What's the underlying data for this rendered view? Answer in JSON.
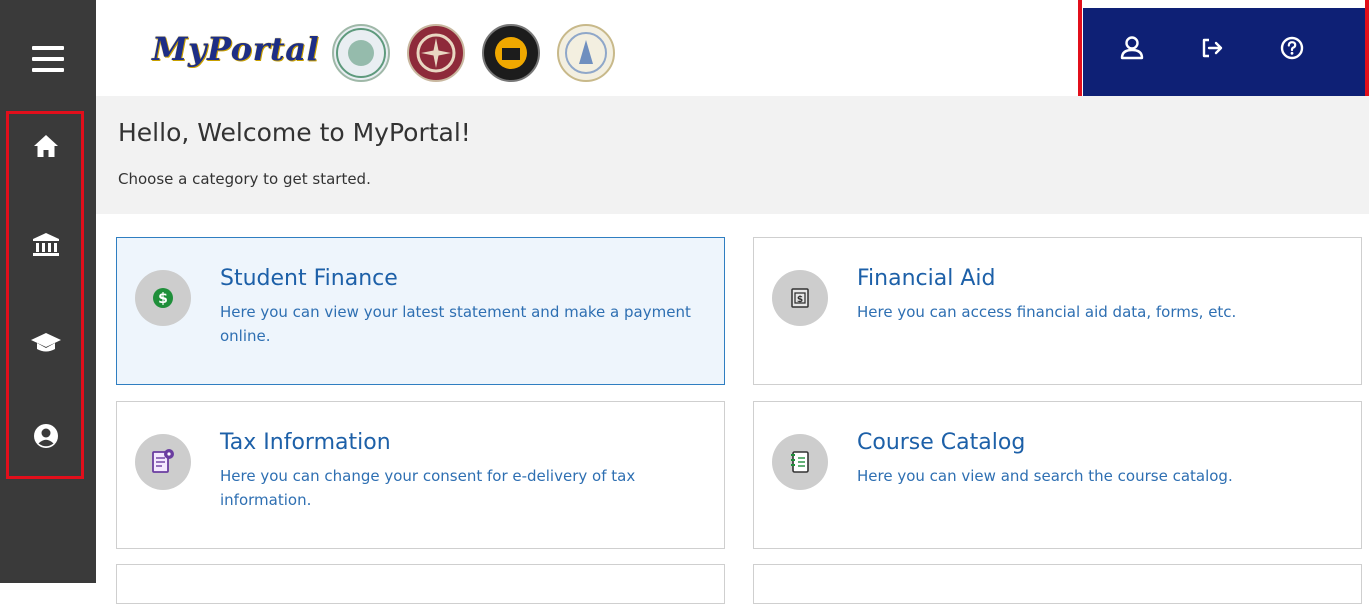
{
  "app": {
    "brand": "MyPortal",
    "seals": [
      "moreno-valley-college-seal",
      "norco-college-seal",
      "riverside-city-college-seal",
      "riverside-ccd-seal"
    ]
  },
  "sidebar": {
    "menu_icon": "hamburger-icon",
    "items": [
      {
        "name": "home",
        "icon": "home-icon"
      },
      {
        "name": "institution",
        "icon": "bank-icon"
      },
      {
        "name": "academics",
        "icon": "graduation-cap-icon"
      },
      {
        "name": "profile",
        "icon": "user-circle-icon"
      }
    ]
  },
  "topbar": {
    "items": [
      {
        "name": "profile",
        "icon": "user-icon"
      },
      {
        "name": "sign-out",
        "icon": "sign-out-icon"
      },
      {
        "name": "help",
        "icon": "help-icon"
      }
    ]
  },
  "welcome": {
    "heading": "Hello, Welcome to MyPortal!",
    "subheading": "Choose a category to get started."
  },
  "cards": [
    {
      "title": "Student Finance",
      "description": "Here you can view your latest statement and make a payment online.",
      "icon": "dollar-coin-icon"
    },
    {
      "title": "Financial Aid",
      "description": "Here you can access financial aid data, forms, etc.",
      "icon": "money-document-icon"
    },
    {
      "title": "Tax Information",
      "description": "Here you can change your consent for e-delivery of tax information.",
      "icon": "tax-form-icon"
    },
    {
      "title": "Course Catalog",
      "description": "Here you can view and search the course catalog.",
      "icon": "catalog-book-icon"
    }
  ],
  "colors": {
    "rail": "#3a3a3a",
    "topbar": "#0e2075",
    "highlight": "#e20f1b",
    "link": "#1d60a8",
    "active_card": "#eef5fc"
  }
}
